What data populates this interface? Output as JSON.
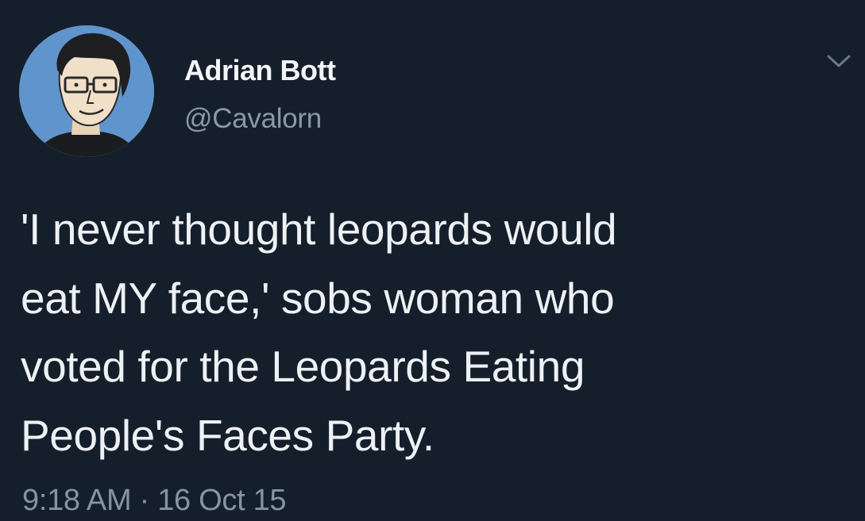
{
  "author": {
    "display_name": "Adrian Bott",
    "handle": "@Cavalorn"
  },
  "tweet": {
    "lines": [
      "'I never thought leopards would",
      "eat MY face,' sobs woman who",
      "voted for the Leopards Eating",
      "People's Faces Party."
    ],
    "time": "9:18 AM",
    "separator": " · ",
    "date": "16 Oct 15"
  },
  "icons": {
    "menu": "chevron-down-icon",
    "avatar": "cartoon-portrait"
  },
  "colors": {
    "background": "#151f2b",
    "primary_text": "#eef1f4",
    "secondary_text": "#8a98a6",
    "avatar_bg": "#5f95cc"
  }
}
